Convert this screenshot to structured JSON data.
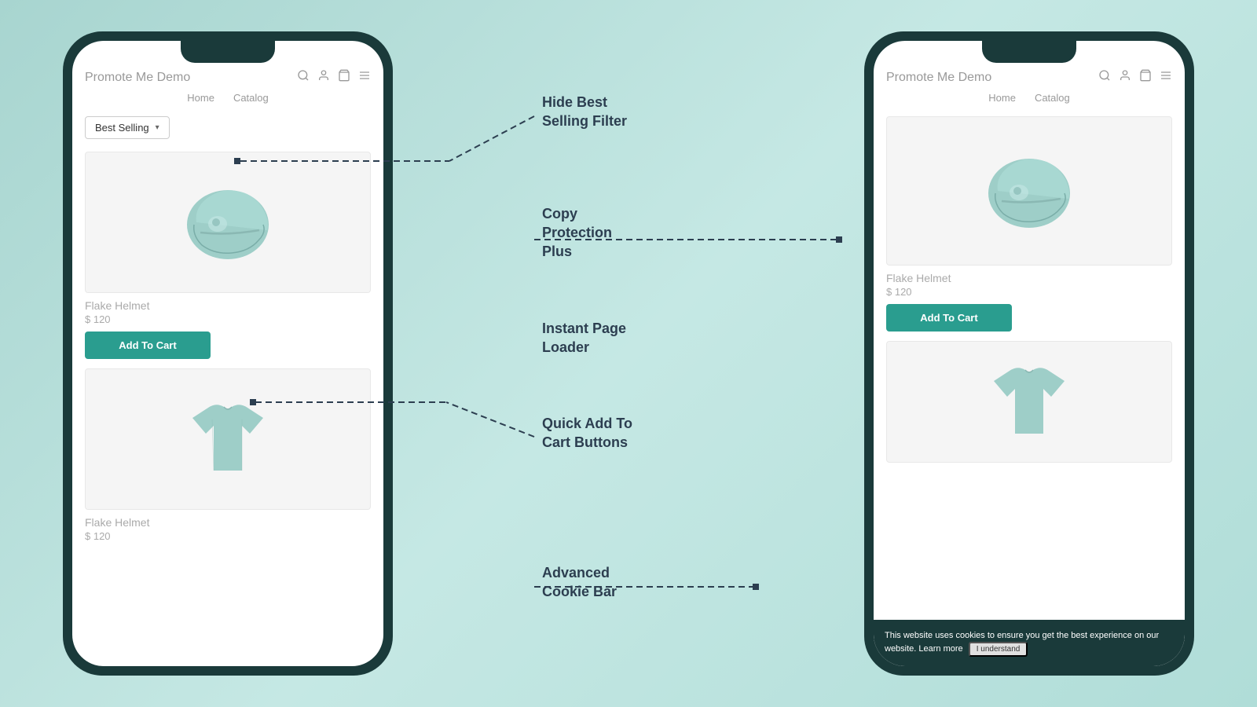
{
  "background": {
    "gradient_start": "#a8d5d0",
    "gradient_end": "#b0ddd8"
  },
  "left_phone": {
    "title": "Promote Me Demo",
    "nav": [
      "Home",
      "Catalog"
    ],
    "icons": [
      "🔍",
      "👤",
      "🛍",
      "☰"
    ],
    "filter": {
      "label": "Best Selling",
      "arrow": "▾"
    },
    "products": [
      {
        "name": "Flake Helmet",
        "price": "$ 120",
        "has_button": true,
        "button_label": "Add To Cart"
      },
      {
        "name": "Flake Helmet",
        "price": "$ 120",
        "has_button": false
      }
    ]
  },
  "right_phone": {
    "title": "Promote Me Demo",
    "nav": [
      "Home",
      "Catalog"
    ],
    "icons": [
      "🔍",
      "👤",
      "🛍",
      "☰"
    ],
    "products": [
      {
        "name": "Flake Helmet",
        "price": "$ 120",
        "has_button": true,
        "button_label": "Add To Cart"
      },
      {
        "name": "",
        "price": "",
        "has_button": false
      }
    ],
    "cookie_bar": {
      "text": "This website uses cookies to ensure you get the best experience on our website. Learn more",
      "button_label": "I understand"
    }
  },
  "labels": [
    {
      "id": "hide-best-selling",
      "text": "Hide Best\nSelling Filter",
      "top_pct": 14
    },
    {
      "id": "copy-protection",
      "text": "Copy\nProtection\nPlus",
      "top_pct": 33
    },
    {
      "id": "instant-page",
      "text": "Instant Page\nLoader",
      "top_pct": 50
    },
    {
      "id": "quick-add",
      "text": "Quick Add To\nCart Buttons",
      "top_pct": 62
    },
    {
      "id": "cookie-bar",
      "text": "Advanced\nCookie Bar",
      "top_pct": 82
    }
  ],
  "accent_color": "#2a9d8f",
  "dark_color": "#1a3a3a"
}
